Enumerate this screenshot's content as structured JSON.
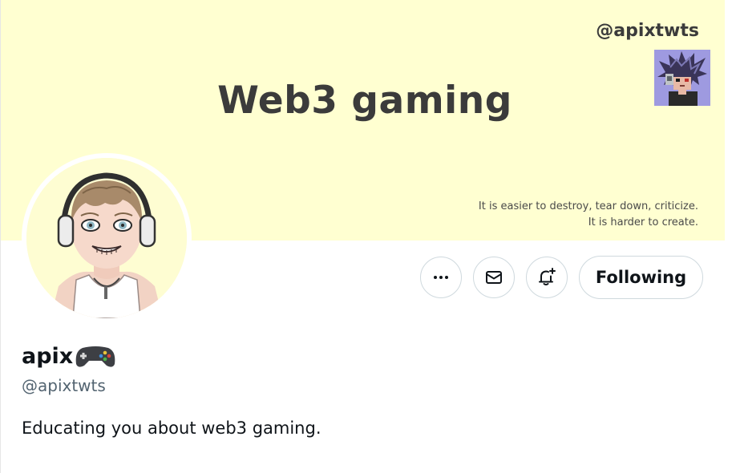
{
  "banner": {
    "title": "Web3 gaming",
    "handle": "@apixtwts",
    "quote_line1": "It is easier to destroy, tear down, criticize.",
    "quote_line2": "It is harder to create.",
    "background": "#ffffd1"
  },
  "actions": {
    "more_icon": "more-horizontal-icon",
    "message_icon": "envelope-icon",
    "notify_icon": "bell-plus-icon",
    "follow_label": "Following"
  },
  "profile": {
    "name": "apix",
    "name_emoji": "gamepad-icon",
    "handle": "@apixtwts",
    "bio": "Educating you about web3 gaming.",
    "next_line_prefix": "",
    "next_line_link": ""
  },
  "colors": {
    "text_primary": "#0f1419",
    "text_secondary": "#536471",
    "border": "#cfd9de",
    "link": "#1d9bf0"
  }
}
